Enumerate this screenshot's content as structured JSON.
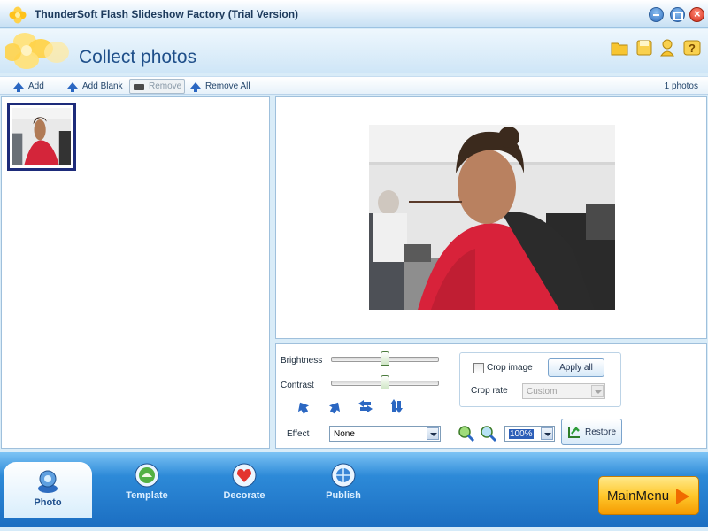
{
  "window": {
    "title": "ThunderSoft Flash Slideshow Factory (Trial Version)"
  },
  "header": {
    "title": "Collect photos"
  },
  "toolbar": {
    "add_label": "Add",
    "add_blank_label": "Add Blank",
    "remove_label": "Remove",
    "remove_all_label": "Remove All",
    "photo_count": "1 photos"
  },
  "controls": {
    "brightness_label": "Brightness",
    "contrast_label": "Contrast",
    "brightness_level": 0.5,
    "contrast_level": 0.5,
    "effect_label": "Effect",
    "effect_value": "None",
    "crop_image_label": "Crop image",
    "crop_rate_label": "Crop rate",
    "crop_rate_value": "Custom",
    "apply_all_label": "Apply all",
    "zoom_value": "100%",
    "restore_label": "Restore"
  },
  "tabs": [
    {
      "label": "Photo",
      "active": true
    },
    {
      "label": "Template",
      "active": false
    },
    {
      "label": "Decorate",
      "active": false
    },
    {
      "label": "Publish",
      "active": false
    }
  ],
  "main_menu_label": "MainMenu",
  "colors": {
    "accent": "#1f4f8a",
    "bottom_bar": "#2d8ad8",
    "main_menu": "#ffc72c"
  }
}
